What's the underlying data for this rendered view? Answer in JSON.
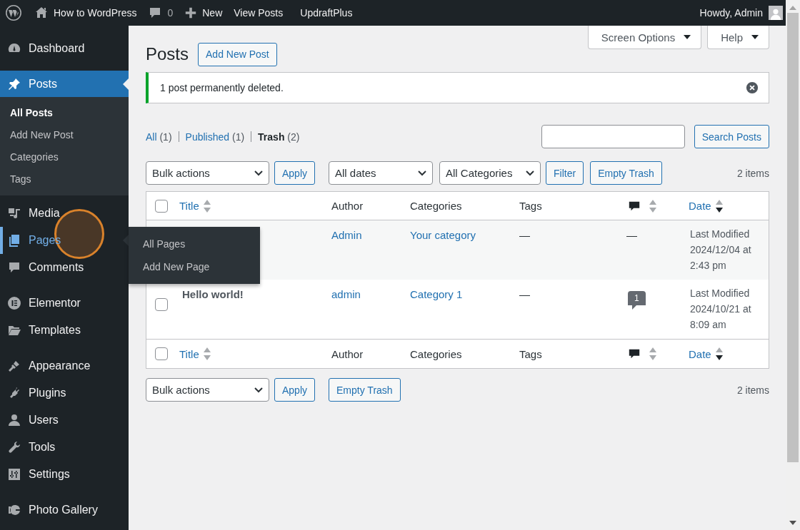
{
  "admin_bar": {
    "site_name": "How to WordPress",
    "comments_count": "0",
    "new_label": "New",
    "links": [
      "View Posts",
      "UpdraftPlus"
    ],
    "greeting": "Howdy, Admin"
  },
  "sidebar": {
    "groups": [
      [
        {
          "label": "Dashboard",
          "selected": false,
          "hovered": false
        }
      ],
      [
        {
          "label": "Posts",
          "selected": true,
          "hovered": false,
          "children": [
            {
              "label": "All Posts",
              "selected": true
            },
            {
              "label": "Add New Post",
              "selected": false
            },
            {
              "label": "Categories",
              "selected": false
            },
            {
              "label": "Tags",
              "selected": false
            }
          ]
        },
        {
          "label": "Media",
          "selected": false,
          "hovered": false
        },
        {
          "label": "Pages",
          "selected": false,
          "hovered": true,
          "children": [
            {
              "label": "All Pages",
              "selected": false
            },
            {
              "label": "Add New Page",
              "selected": false
            }
          ]
        },
        {
          "label": "Comments",
          "selected": false,
          "hovered": false
        }
      ],
      [
        {
          "label": "Elementor",
          "selected": false,
          "hovered": false
        },
        {
          "label": "Templates",
          "selected": false,
          "hovered": false
        }
      ],
      [
        {
          "label": "Appearance",
          "selected": false,
          "hovered": false
        },
        {
          "label": "Plugins",
          "selected": false,
          "hovered": false
        },
        {
          "label": "Users",
          "selected": false,
          "hovered": false
        },
        {
          "label": "Tools",
          "selected": false,
          "hovered": false
        },
        {
          "label": "Settings",
          "selected": false,
          "hovered": false
        }
      ],
      [
        {
          "label": "Photo Gallery",
          "selected": false,
          "hovered": false
        }
      ]
    ]
  },
  "screen_meta": {
    "tabs": [
      "Screen Options",
      "Help"
    ]
  },
  "page_title": "Posts",
  "add_new": "Add New Post",
  "notice": {
    "text": "1 post permanently deleted.",
    "dismissible": true
  },
  "views": [
    {
      "label": "All",
      "count": "(1)",
      "selected": false
    },
    {
      "label": "Published",
      "count": "(1)",
      "selected": false
    },
    {
      "label": "Trash",
      "count": "(2)",
      "selected": true
    }
  ],
  "search": {
    "button": "Search Posts"
  },
  "top_nav": {
    "bulk_action": "Bulk actions",
    "apply": "Apply",
    "date_filter": "All dates",
    "category_filter": "All Categories",
    "filter": "Filter",
    "empty_trash": "Empty Trash",
    "count": "2 items"
  },
  "table": {
    "columns": [
      {
        "kind": "check",
        "checked": false
      },
      {
        "kind": "title",
        "label": "Title",
        "sorted": false
      },
      {
        "kind": "text",
        "label": "Author"
      },
      {
        "kind": "text",
        "label": "Categories"
      },
      {
        "kind": "text",
        "label": "Tags"
      },
      {
        "kind": "comments",
        "sorted": false
      },
      {
        "kind": "date",
        "label": "Date",
        "sorted": true
      }
    ],
    "rows": [
      {
        "author": "Admin",
        "categories": "Your category",
        "tags": "—",
        "comments": {
          "kind": "plain",
          "text": "—"
        },
        "date": "Last Modified 2024/12/04 at 2:43 pm"
      },
      {
        "checked": false,
        "title": "Hello world!",
        "author": "admin",
        "categories": "Category 1",
        "tags": "—",
        "comments": {
          "kind": "bubble",
          "text": "1"
        },
        "date": "Last Modified 2024/10/21 at 8:09 am"
      }
    ],
    "footer_columns": [
      {
        "kind": "check",
        "checked": false
      },
      {
        "kind": "title",
        "label": "Title",
        "sorted": false
      },
      {
        "kind": "text",
        "label": "Author"
      },
      {
        "kind": "text",
        "label": "Categories"
      },
      {
        "kind": "text",
        "label": "Tags"
      },
      {
        "kind": "comments",
        "sorted": false
      },
      {
        "kind": "date",
        "label": "Date",
        "sorted": true
      }
    ]
  },
  "bottom_nav": {
    "bulk_action": "Bulk actions",
    "apply": "Apply",
    "empty_trash": "Empty Trash",
    "count": "2 items"
  }
}
